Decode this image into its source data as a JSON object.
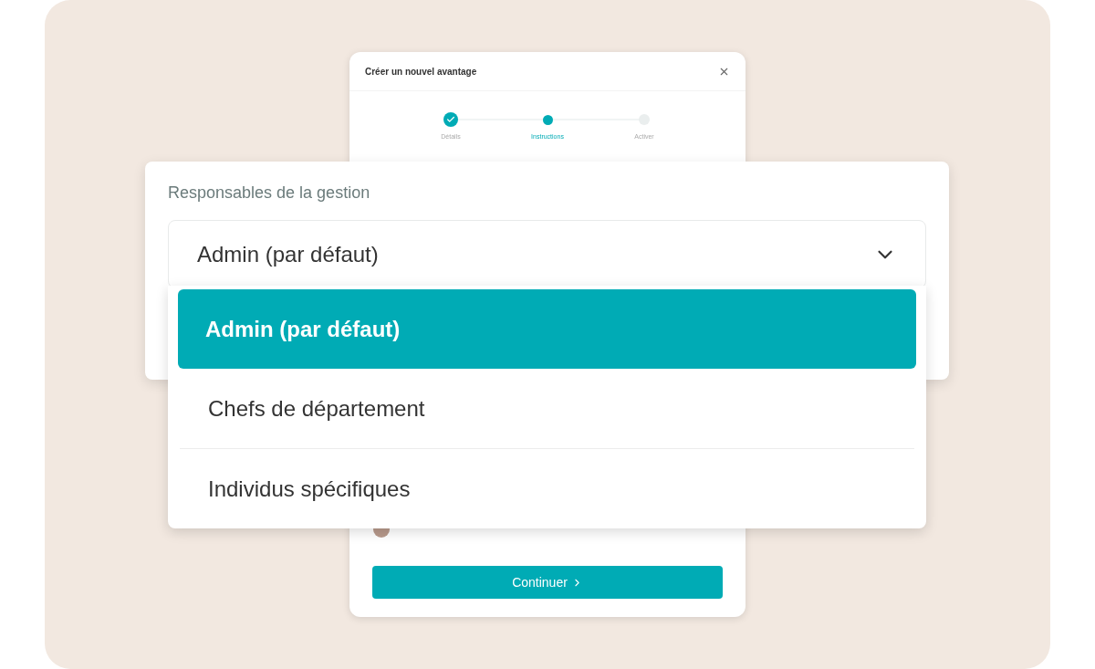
{
  "modal": {
    "title": "Créer un nouvel avantage",
    "steps": [
      {
        "label": "Détails",
        "kind": "done"
      },
      {
        "label": "Instructions",
        "kind": "current"
      },
      {
        "label": "Activer",
        "kind": "upcoming"
      }
    ],
    "button": "Continuer"
  },
  "field": {
    "label": "Responsables de la gestion",
    "value": "Admin (par défaut)",
    "expanded": true
  },
  "options": [
    {
      "label": "Admin (par défaut)",
      "selected": true
    },
    {
      "label": "Chefs de département",
      "selected": false
    },
    {
      "label": "Individus spécifiques",
      "selected": false
    }
  ]
}
